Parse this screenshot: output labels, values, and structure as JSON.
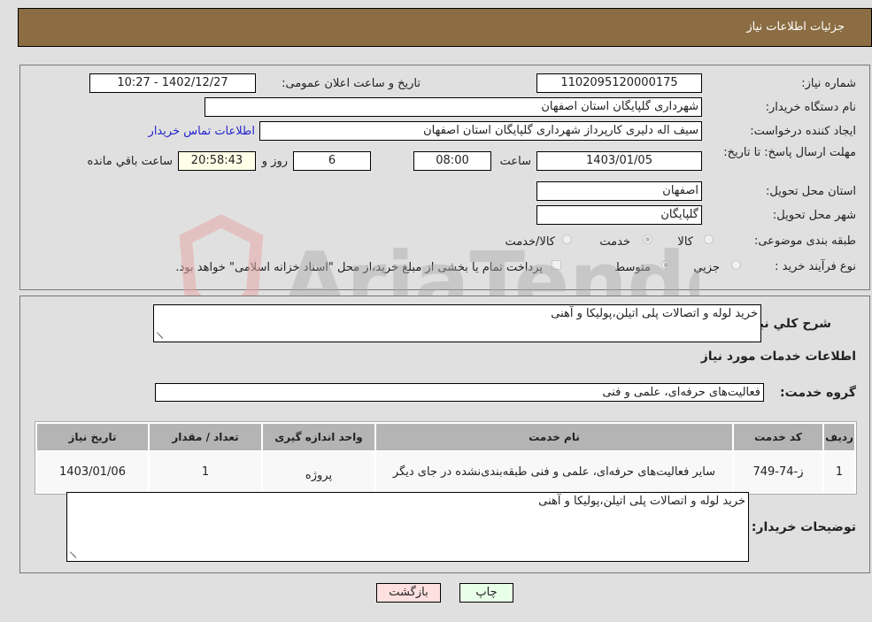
{
  "header": {
    "title": "جزئیات اطلاعات نیاز"
  },
  "form": {
    "need_number_label": "شماره نیاز:",
    "need_number": "1102095120000175",
    "announce_label": "تاریخ و ساعت اعلان عمومی:",
    "announce_value": "1402/12/27 - 10:27",
    "buyer_org_label": "نام دستگاه خریدار:",
    "buyer_org": "شهرداری گلپایگان استان اصفهان",
    "creator_label": "ایجاد کننده درخواست:",
    "creator": "سیف اله دلیری کارپرداز شهرداری گلپایگان استان اصفهان",
    "contact_link": "اطلاعات تماس خریدار",
    "deadline_label": "مهلت ارسال پاسخ: تا تاریخ:",
    "deadline_date": "1403/01/05",
    "time_label": "ساعت",
    "deadline_time": "08:00",
    "days_value": "6",
    "days_label": "روز و",
    "remaining_time": "20:58:43",
    "remaining_label": "ساعت باقي مانده",
    "province_label": "استان محل تحویل:",
    "province": "اصفهان",
    "city_label": "شهر محل تحویل:",
    "city": "گلپایگان",
    "category_label": "طبقه بندی موضوعی:",
    "category_options": [
      {
        "label": "کالا",
        "checked": false
      },
      {
        "label": "خدمت",
        "checked": true
      },
      {
        "label": "کالا/خدمت",
        "checked": false
      }
    ],
    "process_label": "نوع فرآیند خرید :",
    "process_options": [
      {
        "label": "جزيي",
        "checked": false
      },
      {
        "label": "متوسط",
        "checked": true
      }
    ],
    "treasury_note": "پرداخت تمام یا بخشی از مبلغ خرید،از محل \"اسناد خزانه اسلامی\" خواهد بود."
  },
  "details": {
    "description_label": "شرح کلي نياز:",
    "description": "خرید لوله و اتصالات پلی اتیلن،پولیکا و آهنی",
    "services_heading": "اطلاعات خدمات مورد نیاز",
    "service_group_label": "گروه خدمت:",
    "service_group": "فعالیت‌های حرفه‌ای، علمی و فنی",
    "table": {
      "headers": [
        "ردیف",
        "کد خدمت",
        "نام خدمت",
        "واحد اندازه گیری",
        "تعداد / مقدار",
        "تاریخ نیاز"
      ],
      "rows": [
        [
          "1",
          "ز-74-749",
          "سایر فعالیت‌های حرفه‌ای، علمی و فنی طبقه‌بندی‌نشده در جای دیگر",
          "پروژه",
          "1",
          "1403/01/06"
        ]
      ]
    },
    "buyer_notes_label": "توضیحات خریدار:",
    "buyer_notes": "خرید لوله و اتصالات پلی اتیلن،پولیکا و آهنی"
  },
  "buttons": {
    "print": "چاپ",
    "back": "بازگشت"
  },
  "watermark": {
    "text": "AriaTender.neT"
  },
  "colors": {
    "header_bg": "#8c6d43",
    "back_btn_bg": "#ffe0e0",
    "print_btn_bg": "#e8ffe8"
  }
}
